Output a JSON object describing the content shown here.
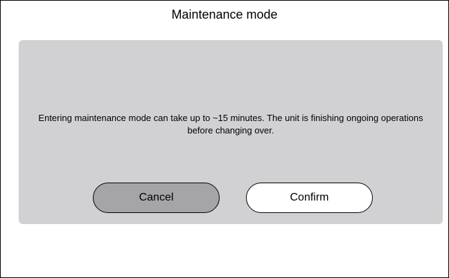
{
  "dialog": {
    "title": "Maintenance mode",
    "message": "Entering maintenance mode can take up to ~15 minutes. The unit is finishing ongoing operations before changing over.",
    "cancel_label": "Cancel",
    "confirm_label": "Confirm"
  },
  "colors": {
    "panel_background": "#d1d1d3",
    "cancel_button": "#a5a5a7",
    "confirm_button": "#ffffff",
    "border": "#000000"
  }
}
